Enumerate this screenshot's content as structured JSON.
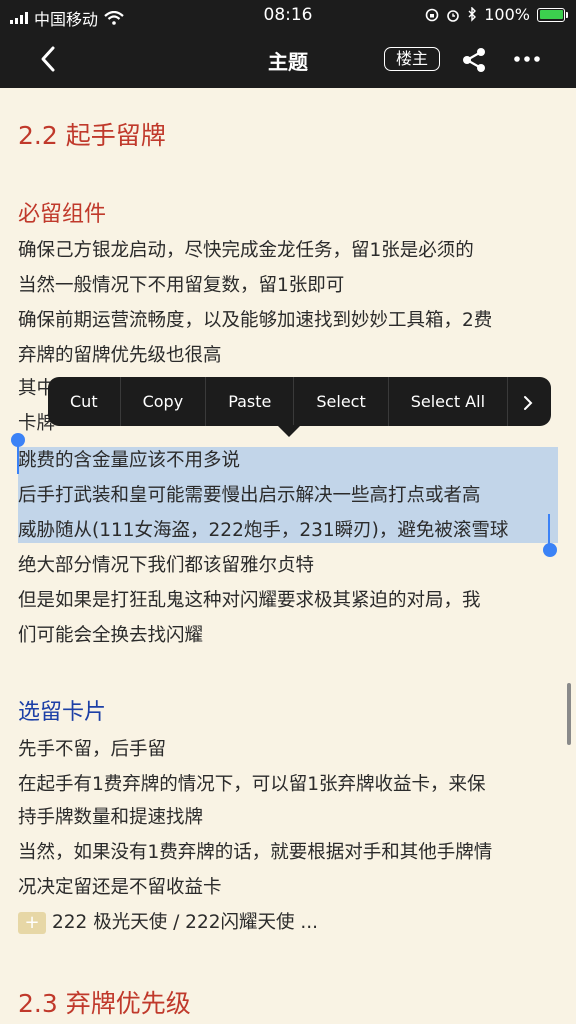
{
  "status_bar": {
    "carrier": "中国移动",
    "time": "08:16",
    "battery": "100%",
    "battery_level": 1.0
  },
  "nav": {
    "back_icon": "chevron-left-icon",
    "title": "主题",
    "op_badge": "楼主",
    "share_icon": "share-icon",
    "more_icon": "more-icon"
  },
  "content": {
    "section_2_2": "2.2 起手留牌",
    "must_keep_heading": "必留组件",
    "must_keep_lines": [
      "确保己方银龙启动，尽快完成金龙任务，留1张是必须的",
      "当然一般情况下不用留复数，留1张即可",
      "确保前期运营流畅度，以及能够加速找到妙妙工具箱，2费",
      "弃牌的留牌优先级也很高",
      "其中",
      "卡牌",
      "跳费的含金量应该不用多说",
      "后手打武装和皇可能需要慢出启示解决一些高打点或者高",
      "威胁随从(111女海盗，222炮手，231瞬刃)，避免被滚雪球",
      "绝大部分情况下我们都该留雅尔贞特",
      "但是如果是打狂乱鬼这种对闪耀要求极其紧迫的对局，我",
      "们可能会全换去找闪耀"
    ],
    "optional_heading": "选留卡片",
    "optional_lines": [
      "先手不留，后手留",
      "在起手有1费弃牌的情况下，可以留1张弃牌收益卡，来保",
      "持手牌数量和提速找牌",
      "当然，如果没有1费弃牌的话，就要根据对手和其他手牌情",
      "况决定留还是不留收益卡"
    ],
    "attachment_text": "222 极光天使 / 222闪耀天使 ...",
    "section_2_3": "2.3 弃牌优先级"
  },
  "context_menu": {
    "items": [
      "Cut",
      "Copy",
      "Paste",
      "Select",
      "Select All"
    ],
    "next_icon": "chevron-right-icon"
  }
}
